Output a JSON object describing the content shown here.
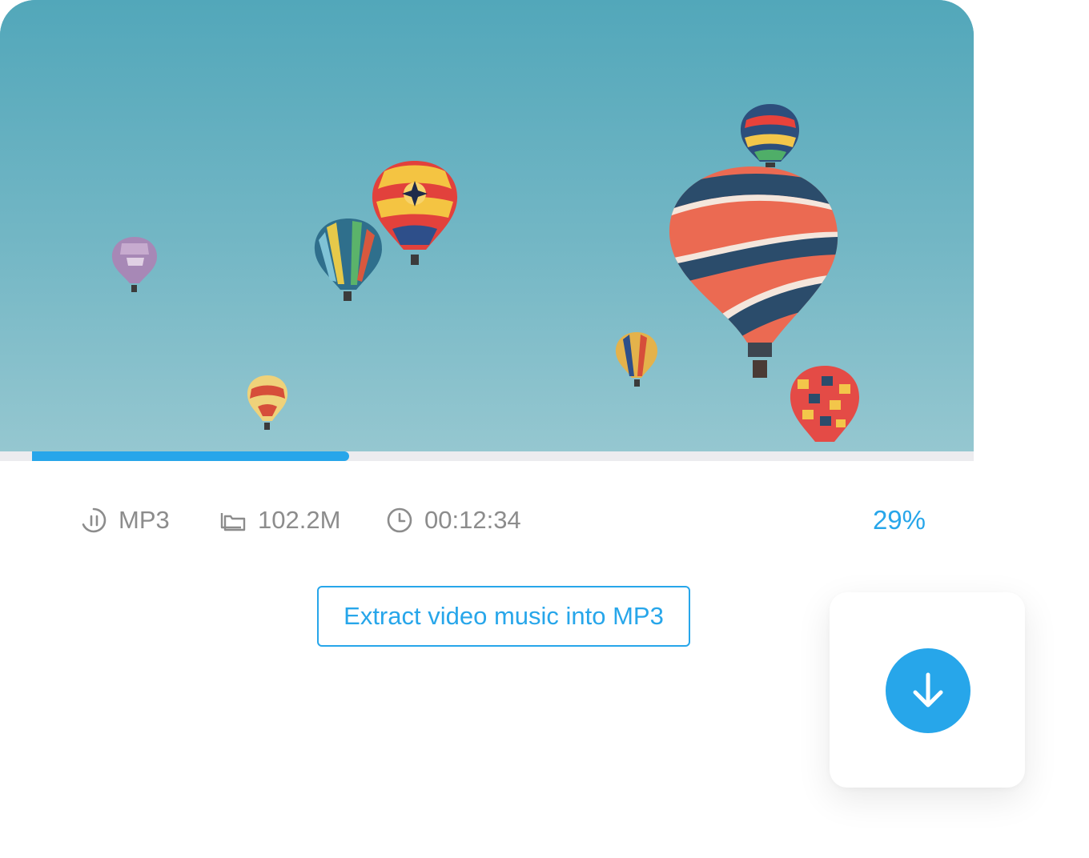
{
  "video": {
    "thumbnail": "hot-air-balloons-sky",
    "progress_percent": 29,
    "progress_color": "#27a6ea"
  },
  "meta": {
    "format_icon": "audio-pause-icon",
    "format": "MP3",
    "size_icon": "folder-icon",
    "size": "102.2M",
    "duration_icon": "clock-icon",
    "duration": "00:12:34",
    "percent": "29%"
  },
  "actions": {
    "extract_label": "Extract video music into MP3",
    "download_icon": "download-arrow-icon"
  },
  "colors": {
    "accent": "#27a6ea",
    "meta_text": "#8c8c8c"
  }
}
